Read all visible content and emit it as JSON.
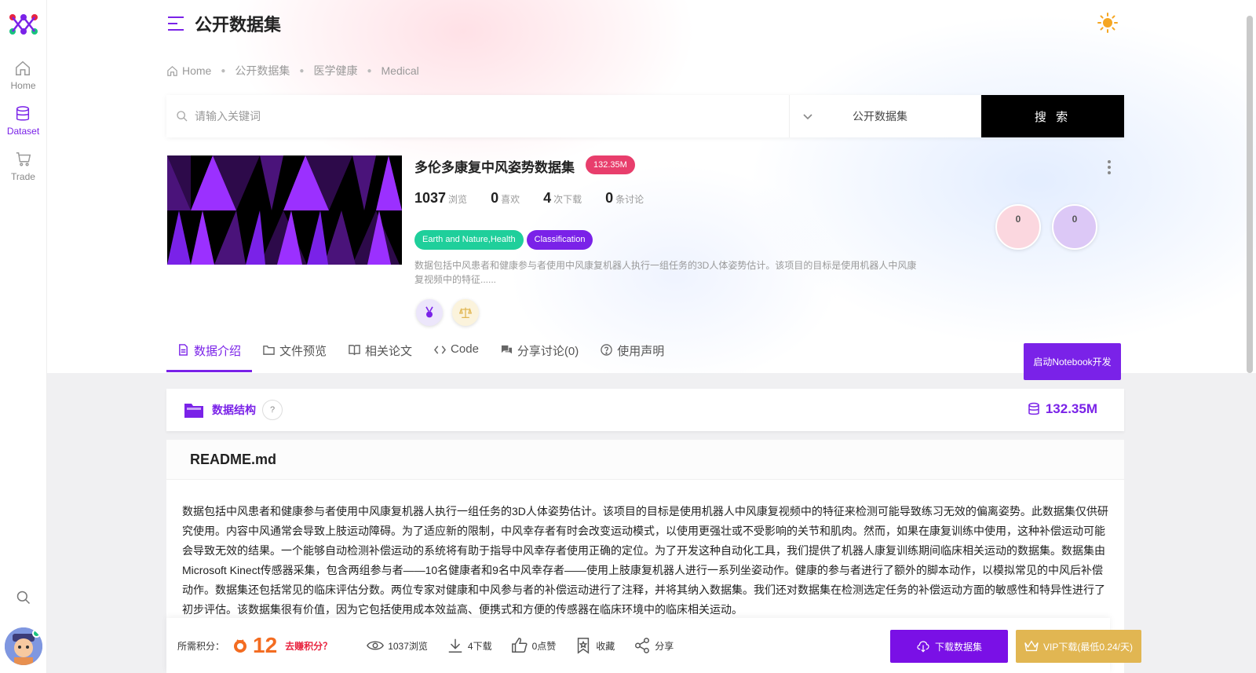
{
  "sidebar": {
    "items": [
      {
        "label": "Home",
        "icon": "home-icon"
      },
      {
        "label": "Dataset",
        "icon": "database-icon",
        "active": true
      },
      {
        "label": "Trade",
        "icon": "cart-icon"
      }
    ]
  },
  "header": {
    "title": "公开数据集"
  },
  "breadcrumb": {
    "items": [
      "Home",
      "公开数据集",
      "医学健康",
      "Medical"
    ]
  },
  "search": {
    "placeholder": "请输入关键词",
    "scope": "公开数据集",
    "button": "搜 索"
  },
  "dataset": {
    "title": "多伦多康复中风姿势数据集",
    "size_badge": "132.35M",
    "stats": [
      {
        "num": "1037",
        "label": "浏览"
      },
      {
        "num": "0",
        "label": "喜欢"
      },
      {
        "num": "4",
        "label": "次下载"
      },
      {
        "num": "0",
        "label": "条讨论"
      }
    ],
    "tags": [
      "Earth and Nature,Health",
      "Classification"
    ],
    "description": "数据包括中风患者和健康参与者使用中风康复机器人执行一组任务的3D人体姿势估计。该项目的目标是使用机器人中风康复视频中的特征......",
    "circles": [
      "0",
      "0"
    ]
  },
  "tabs": [
    {
      "label": "数据介绍",
      "icon": "file-icon",
      "active": true
    },
    {
      "label": "文件预览",
      "icon": "folder-icon"
    },
    {
      "label": "相关论文",
      "icon": "book-icon"
    },
    {
      "label": "Code",
      "icon": "code-icon"
    },
    {
      "label": "分享讨论(0)",
      "icon": "chat-icon"
    },
    {
      "label": "使用声明",
      "icon": "help-icon"
    }
  ],
  "notebook_button": "启动Notebook开发",
  "structure": {
    "title": "数据结构",
    "help": "?",
    "size": "132.35M"
  },
  "readme": {
    "title": "README.md",
    "body": "数据包括中风患者和健康参与者使用中风康复机器人执行一组任务的3D人体姿势估计。该项目的目标是使用机器人中风康复视频中的特征来检测可能导致练习无效的偏离姿势。此数据集仅供研究使用。内容中风通常会导致上肢运动障碍。为了适应新的限制，中风幸存者有时会改变运动模式，以使用更强壮或不受影响的关节和肌肉。然而，如果在康复训练中使用，这种补偿运动可能会导致无效的结果。一个能够自动检测补偿运动的系统将有助于指导中风幸存者使用正确的定位。为了开发这种自动化工具，我们提供了机器人康复训练期间临床相关运动的数据集。数据集由Microsoft Kinect传感器采集，包含两组参与者——10名健康者和9名中风幸存者——使用上肢康复机器人进行一系列坐姿动作。健康的参与者进行了额外的脚本动作，以模拟常见的中风后补偿动作。数据集还包括常见的临床评估分数。两位专家对健康和中风参与者的补偿运动进行了注释，并将其纳入数据集。我们还对数据集在检测选定任务的补偿运动方面的敏感性和特异性进行了初步评估。该数据集很有价值，因为它包括使用成本效益高、便携式和方便的传感器在临床环境中的临床相关运动。"
  },
  "bottom": {
    "points_label": "所需积分：",
    "points": "12",
    "earn": "去赚积分？",
    "views": "1037浏览",
    "downloads": "4下载",
    "likes": "0点赞",
    "favorite": "收藏",
    "share": "分享",
    "download_button": "下载数据集",
    "vip_button": "VIP下载(最低0.24/天)"
  },
  "colors": {
    "accent": "#7a22e8",
    "badge": "#e83e6c",
    "tag_green": "#1fcf9b",
    "points": "#f36c21",
    "vip": "#e1b652"
  }
}
